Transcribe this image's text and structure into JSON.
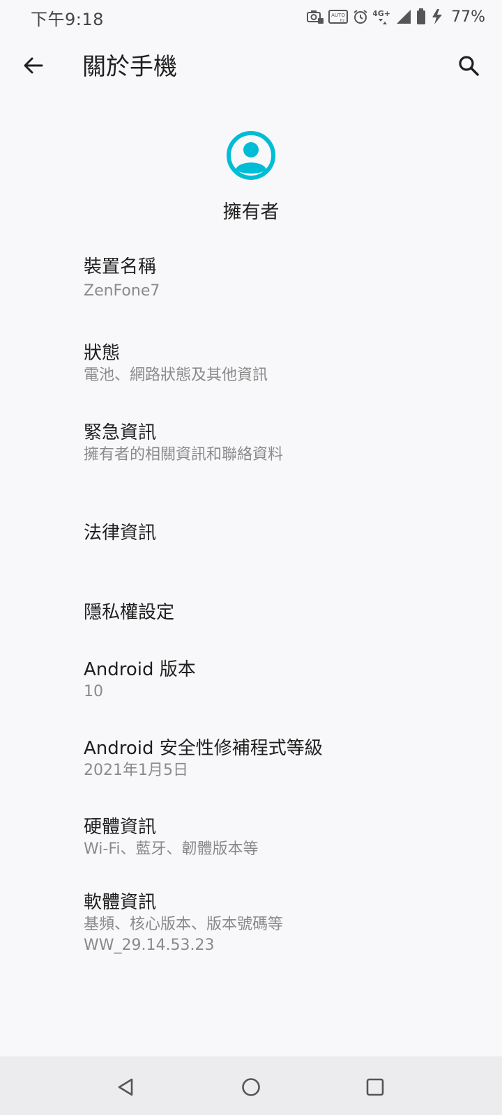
{
  "status_bar": {
    "time": "下午9:18",
    "network": "4G+",
    "battery": "77%"
  },
  "app_bar": {
    "title": "關於手機",
    "back_icon": "arrow-back-icon",
    "search_icon": "search-icon"
  },
  "owner": {
    "name": "擁有者",
    "avatar_icon": "account-circle-icon",
    "avatar_color": "#00bcd4"
  },
  "items": [
    {
      "title": "裝置名稱",
      "summary": "ZenFone7"
    },
    {
      "title": "狀態",
      "summary": "電池、網路狀態及其他資訊"
    },
    {
      "title": "緊急資訊",
      "summary": "擁有者的相關資訊和聯絡資料"
    },
    {
      "title": "法律資訊",
      "summary": ""
    },
    {
      "title": "隱私權設定",
      "summary": ""
    },
    {
      "title": "Android 版本",
      "summary": "10"
    },
    {
      "title": "Android 安全性修補程式等級",
      "summary": "2021年1月5日"
    },
    {
      "title": "硬體資訊",
      "summary": "Wi-Fi、藍牙、韌體版本等"
    },
    {
      "title": "軟體資訊",
      "summary": "基頻、核心版本、版本號碼等",
      "summary2": "WW_29.14.53.23"
    }
  ],
  "nav_bar": {
    "back_icon": "nav-back-icon",
    "home_icon": "nav-home-icon",
    "recents_icon": "nav-recents-icon"
  }
}
